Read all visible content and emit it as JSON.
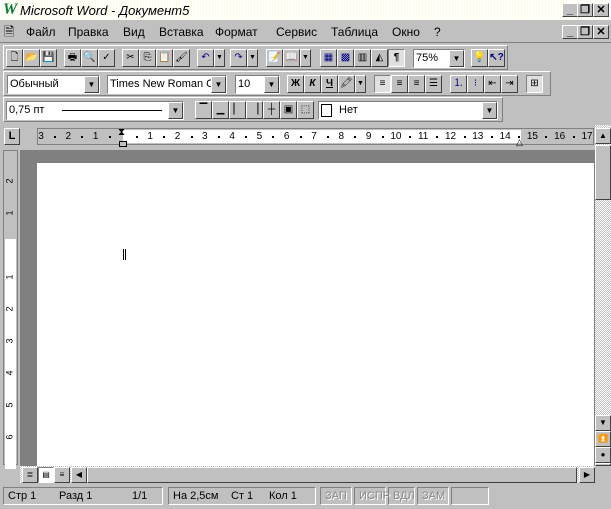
{
  "window": {
    "title": "Microsoft Word - Документ5",
    "app_icon": "word-w-icon"
  },
  "window_controls": {
    "minimize": "_",
    "restore": "❐",
    "close": "✕"
  },
  "menu": [
    "Файл",
    "Правка",
    "Вид",
    "Вставка",
    "Формат",
    "Сервис",
    "Таблица",
    "Окно",
    "?"
  ],
  "standard_toolbar": {
    "zoom": "75%"
  },
  "formatting_toolbar": {
    "style": "Обычный",
    "font": "Times New Roman C",
    "size": "10",
    "bold": "Ж",
    "italic": "К",
    "underline": "Ч"
  },
  "borders_toolbar": {
    "line_weight": "0,75 пт",
    "shading": "Нет"
  },
  "ruler": {
    "tab_selector": "L",
    "labels": [
      "3",
      "2",
      "1",
      "",
      "1",
      "2",
      "3",
      "4",
      "5",
      "6",
      "7",
      "8",
      "9",
      "10",
      "11",
      "12",
      "13",
      "14",
      "15",
      "16",
      "17"
    ],
    "vertical_labels": [
      "2",
      "1",
      "",
      "1",
      "2",
      "3",
      "4",
      "5",
      "6"
    ]
  },
  "status": {
    "page": "Стр 1",
    "section": "Разд 1",
    "pages": "1/1",
    "at": "На 2,5см",
    "line": "Ст 1",
    "col": "Кол 1",
    "rec": "ЗАП",
    "trk": "ИСПР",
    "ext": "ВДЛ",
    "ovr": "ЗАМ"
  }
}
